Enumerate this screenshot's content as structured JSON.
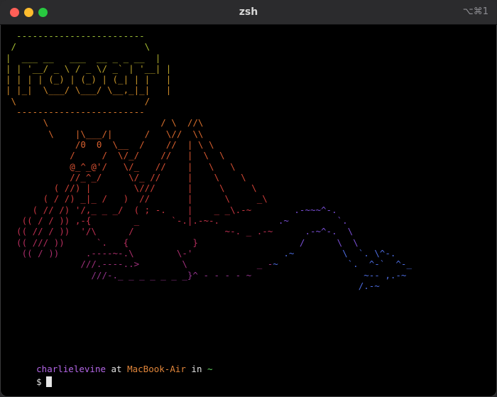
{
  "window": {
    "title": "zsh",
    "shortcut": "⌥⌘1"
  },
  "art": {
    "lines": [
      {
        "text": "  ------------------------",
        "color": "#9dc036"
      },
      {
        "text": " /                        \\",
        "color": "#a7be32"
      },
      {
        "text": "|  ___ __   ___  __ _ _ __  |",
        "color": "#b0b02e"
      },
      {
        "text": "| | '__/ _ \\ / _ \\/ _` | '__| |",
        "color": "#bba52b"
      },
      {
        "text": "| | | | (_) | (_) | (_| | |   |",
        "color": "#c7972a"
      },
      {
        "text": "| |_|  \\___/ \\___/ \\__,_|_|   |",
        "color": "#d08a2a"
      },
      {
        "text": " \\                        /",
        "color": "#d6802b"
      },
      {
        "text": "  ------------------------",
        "color": "#d8782c"
      },
      {
        "text": "       \\                     / \\  //\\",
        "color": "#d9702d"
      },
      {
        "text": "        \\    |\\___/|      /   \\//  \\\\",
        "color": "#d9682e"
      },
      {
        "text": "             /0  0  \\__  /    //  | \\ \\",
        "color": "#d8602f"
      },
      {
        "text": "            /     /  \\/_/    //   |  \\  \\",
        "color": "#d75830"
      },
      {
        "text": "            @_^_@'/   \\/_   //    |   \\   \\",
        "color": "#d55032"
      },
      {
        "text": "            //_^_/     \\/_ //     |    \\    \\",
        "color": "#d34834"
      },
      {
        "text": "         ( //) |        \\///      |     \\     \\",
        "color": "#d04236"
      },
      {
        "text": "       ( / /) _|_ /   )  //       |      \\     _\\",
        "color": "#cc3c3a"
      },
      {
        "text": "     ( // /) '/,_ _ _/  ( ; -.    |    _ _\\.-~        .-~~~^-.",
        "color": "#c83640"
      },
      {
        "text": "   (( / / )) ,-{        _      `-.|.-~-.           .~         `.",
        "color": "#c33248"
      },
      {
        "text": "  (( // / ))  '/\\      /                 ~-. _ .-~      .-~^-.  \\",
        "color": "#bd2f52"
      },
      {
        "text": "  (( /// ))      `.   {            }                   /      \\  \\",
        "color": "#b52e5e"
      },
      {
        "text": "   (( / ))     .----~-.\\        \\-'                 .~         \\  `. \\^-.",
        "color": "#ab2e6c"
      },
      {
        "text": "              ///.----..>        \\             _ -~             `.  ^-`  ^-_",
        "color": "#a0307c"
      },
      {
        "text": "                ///-._ _ _ _ _ _ _}^ - - - - ~                     ~-- ,.-~",
        "color": "#93348d"
      },
      {
        "text": "                                                                  /.-~",
        "color": "#7c3aa8"
      }
    ],
    "tail_colors": {
      "mid": "#7a4fd6",
      "end": "#4d6ce0"
    }
  },
  "prompt": {
    "user": "charlielevine",
    "at": " at ",
    "host": "MacBook-Air",
    "in": " in ",
    "dir": "~",
    "symbol": "$"
  },
  "colors": {
    "user": "#b366e6",
    "host": "#e0853a",
    "dir": "#5fd35f",
    "plain": "#e0e0e0"
  }
}
